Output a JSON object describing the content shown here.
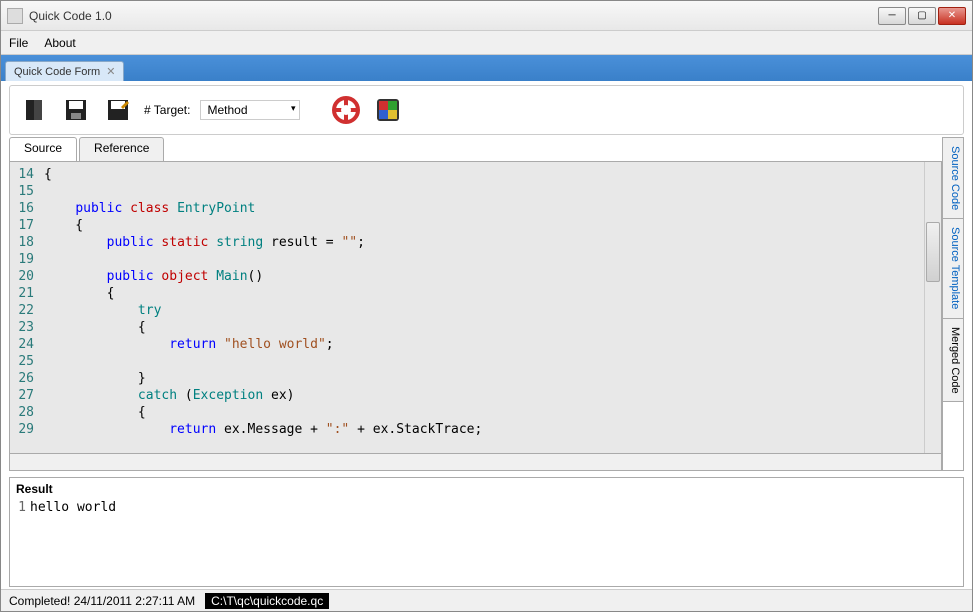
{
  "window": {
    "title": "Quick Code 1.0"
  },
  "menu": {
    "file": "File",
    "about": "About"
  },
  "docTab": {
    "label": "Quick Code Form"
  },
  "toolbar": {
    "targetLabel": "# Target:",
    "targetValue": "Method"
  },
  "editorTabs": {
    "source": "Source",
    "reference": "Reference"
  },
  "code": {
    "startLine": 14,
    "lines": [
      {
        "n": 14,
        "segs": [
          {
            "t": "{",
            "c": ""
          }
        ]
      },
      {
        "n": 15,
        "segs": []
      },
      {
        "n": 16,
        "segs": [
          {
            "t": "    ",
            "c": ""
          },
          {
            "t": "public",
            "c": "kw-blue"
          },
          {
            "t": " ",
            "c": ""
          },
          {
            "t": "class",
            "c": "kw-red"
          },
          {
            "t": " ",
            "c": ""
          },
          {
            "t": "EntryPoint",
            "c": "kw-teal"
          }
        ]
      },
      {
        "n": 17,
        "segs": [
          {
            "t": "    {",
            "c": ""
          }
        ]
      },
      {
        "n": 18,
        "segs": [
          {
            "t": "        ",
            "c": ""
          },
          {
            "t": "public",
            "c": "kw-blue"
          },
          {
            "t": " ",
            "c": ""
          },
          {
            "t": "static",
            "c": "kw-red"
          },
          {
            "t": " ",
            "c": ""
          },
          {
            "t": "string",
            "c": "kw-teal"
          },
          {
            "t": " result = ",
            "c": ""
          },
          {
            "t": "\"\"",
            "c": "str"
          },
          {
            "t": ";",
            "c": ""
          }
        ]
      },
      {
        "n": 19,
        "segs": []
      },
      {
        "n": 20,
        "segs": [
          {
            "t": "        ",
            "c": ""
          },
          {
            "t": "public",
            "c": "kw-blue"
          },
          {
            "t": " ",
            "c": ""
          },
          {
            "t": "object",
            "c": "kw-red"
          },
          {
            "t": " ",
            "c": ""
          },
          {
            "t": "Main",
            "c": "kw-teal"
          },
          {
            "t": "()",
            "c": ""
          }
        ]
      },
      {
        "n": 21,
        "segs": [
          {
            "t": "        {",
            "c": ""
          }
        ]
      },
      {
        "n": 22,
        "segs": [
          {
            "t": "            ",
            "c": ""
          },
          {
            "t": "try",
            "c": "kw-teal"
          }
        ]
      },
      {
        "n": 23,
        "segs": [
          {
            "t": "            {",
            "c": ""
          }
        ]
      },
      {
        "n": 24,
        "segs": [
          {
            "t": "                ",
            "c": ""
          },
          {
            "t": "return",
            "c": "kw-blue"
          },
          {
            "t": " ",
            "c": ""
          },
          {
            "t": "\"hello world\"",
            "c": "str"
          },
          {
            "t": ";",
            "c": ""
          }
        ]
      },
      {
        "n": 25,
        "segs": []
      },
      {
        "n": 26,
        "segs": [
          {
            "t": "            }",
            "c": ""
          }
        ]
      },
      {
        "n": 27,
        "segs": [
          {
            "t": "            ",
            "c": ""
          },
          {
            "t": "catch",
            "c": "kw-teal"
          },
          {
            "t": " (",
            "c": ""
          },
          {
            "t": "Exception",
            "c": "kw-teal"
          },
          {
            "t": " ex)",
            "c": ""
          }
        ]
      },
      {
        "n": 28,
        "segs": [
          {
            "t": "            {",
            "c": ""
          }
        ]
      },
      {
        "n": 29,
        "segs": [
          {
            "t": "                ",
            "c": ""
          },
          {
            "t": "return",
            "c": "kw-blue"
          },
          {
            "t": " ex.Message + ",
            "c": ""
          },
          {
            "t": "\":\"",
            "c": "str"
          },
          {
            "t": " + ex.StackTrace;",
            "c": ""
          }
        ]
      }
    ]
  },
  "sideTabs": {
    "a": "Source Code",
    "b": "Source Template",
    "c": "Merged Code"
  },
  "result": {
    "title": "Result",
    "line": "1",
    "text": "hello world"
  },
  "status": {
    "msg": "Completed! 24/11/2011 2:27:11 AM",
    "path": "C:\\T\\qc\\quickcode.qc"
  }
}
